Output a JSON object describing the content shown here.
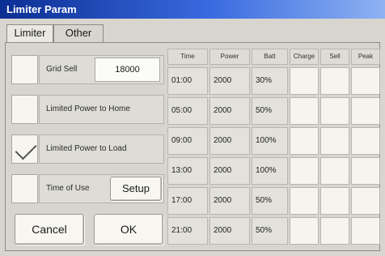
{
  "window": {
    "title": "Limiter Param"
  },
  "tabs": [
    {
      "label": "Limiter",
      "active": true
    },
    {
      "label": "Other",
      "active": false
    }
  ],
  "options": [
    {
      "label": "Grid Sell",
      "checked": false,
      "value": "18000"
    },
    {
      "label": "Limited Power to Home",
      "checked": false
    },
    {
      "label": "Limited Power to Load",
      "checked": true
    },
    {
      "label": "Time of Use",
      "checked": false,
      "button": "Setup"
    }
  ],
  "footer": {
    "cancel_label": "Cancel",
    "ok_label": "OK"
  },
  "schedule": {
    "headers": [
      "Time",
      "Power",
      "Batt",
      "Charge",
      "Sell",
      "Peak"
    ],
    "rows": [
      {
        "time": "01:00",
        "power": "2000",
        "batt": "30%"
      },
      {
        "time": "05:00",
        "power": "2000",
        "batt": "50%"
      },
      {
        "time": "09:00",
        "power": "2000",
        "batt": "100%"
      },
      {
        "time": "13:00",
        "power": "2000",
        "batt": "100%"
      },
      {
        "time": "17:00",
        "power": "2000",
        "batt": "50%"
      },
      {
        "time": "21:00",
        "power": "2000",
        "batt": "50%"
      }
    ]
  }
}
